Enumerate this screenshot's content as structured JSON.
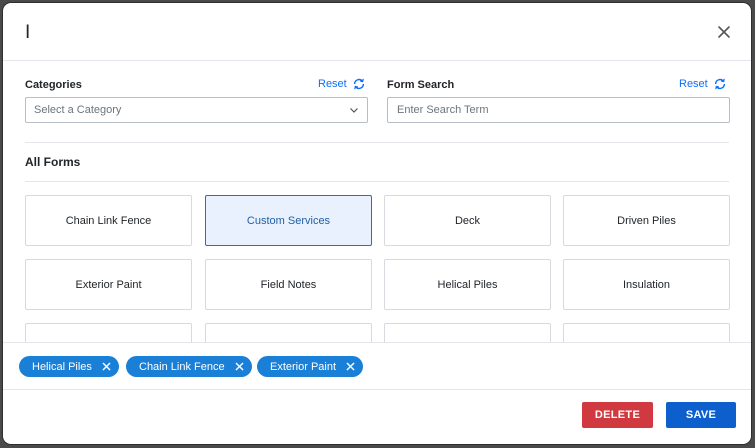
{
  "header": {
    "title": "I"
  },
  "categories": {
    "label": "Categories",
    "reset_label": "Reset",
    "select_placeholder": "Select a Category"
  },
  "form_search": {
    "label": "Form Search",
    "reset_label": "Reset",
    "placeholder": "Enter Search Term"
  },
  "forms": {
    "section_title": "All Forms",
    "tiles": [
      {
        "label": "Chain Link Fence",
        "selected": false
      },
      {
        "label": "Custom Services",
        "selected": true
      },
      {
        "label": "Deck",
        "selected": false
      },
      {
        "label": "Driven Piles",
        "selected": false
      },
      {
        "label": "Exterior Paint",
        "selected": false
      },
      {
        "label": "Field Notes",
        "selected": false
      },
      {
        "label": "Helical Piles",
        "selected": false
      },
      {
        "label": "Insulation",
        "selected": false
      },
      {
        "label": "",
        "selected": false
      },
      {
        "label": "",
        "selected": false
      },
      {
        "label": "",
        "selected": false
      },
      {
        "label": "",
        "selected": false
      }
    ]
  },
  "selected_chips": [
    {
      "label": "Helical Piles"
    },
    {
      "label": "Chain Link Fence"
    },
    {
      "label": "Exterior Paint"
    }
  ],
  "footer": {
    "delete_label": "DELETE",
    "save_label": "SAVE"
  },
  "icons": {
    "close": "close-icon",
    "reset": "refresh-icon",
    "chevron": "chevron-down-icon",
    "chip_remove": "close-icon"
  },
  "colors": {
    "primary": "#0d5fce",
    "chip": "#1a7fd6",
    "danger": "#d0393f",
    "link": "#0d6efd",
    "selected_tile_bg": "#e8f1fd"
  }
}
